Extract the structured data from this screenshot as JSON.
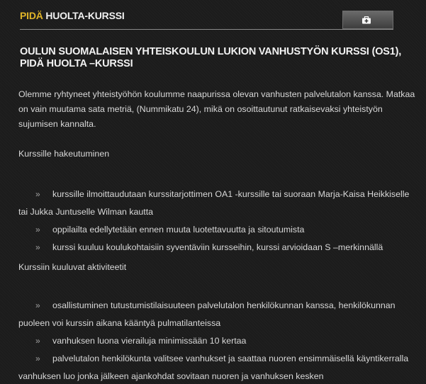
{
  "header": {
    "title_accent": "PIDÄ",
    "title_rest": " HUOLTA-KURSSI",
    "action_icon": "first-aid-box-icon",
    "accent_color": "#e0b428"
  },
  "article": {
    "title": "OULUN SUOMALAISEN YHTEISKOULUN LUKION VANHUSTYÖN KURSSI (OS1), PIDÄ HUOLTA –KURSSI",
    "intro": "Olemme ryhtyneet yhteistyöhön koulumme naapurissa olevan vanhusten palvelutalon kanssa. Matkaa on vain muutama sata metriä, (Nummikatu 24), mikä on osoittautunut ratkaisevaksi yhteistyön sujumisen kannalta.",
    "section1": {
      "heading": "Kurssille hakeutuminen",
      "items": [
        "kurssille ilmoittaudutaan kurssitarjottimen OA1 -kurssille tai suoraan Marja-Kaisa Heikkiselle tai Jukka Juntuselle Wilman kautta",
        "oppilailta edellytetään ennen muuta luotettavuutta ja sitoutumista",
        "kurssi kuuluu koulukohtaisiin syventäviin kursseihin, kurssi arvioidaan S –merkinnällä"
      ]
    },
    "section2": {
      "heading": "Kurssiin kuuluvat aktiviteetit",
      "items": [
        "osallistuminen tutustumistilaisuuteen palvelutalon henkilökunnan kanssa, henkilökunnan puoleen voi kurssin aikana kääntyä pulmatilanteissa",
        "vanhuksen luona vierailuja minimissään 10 kertaa",
        "palvelutalon henkilökunta valitsee vanhukset ja saattaa nuoren ensimmäisellä käyntikerralla vanhuksen luo jonka jälkeen ajankohdat sovitaan nuoren ja vanhuksen kesken"
      ]
    },
    "bullet_icon": "arrow-right-icon",
    "bullet_glyph": "»"
  }
}
